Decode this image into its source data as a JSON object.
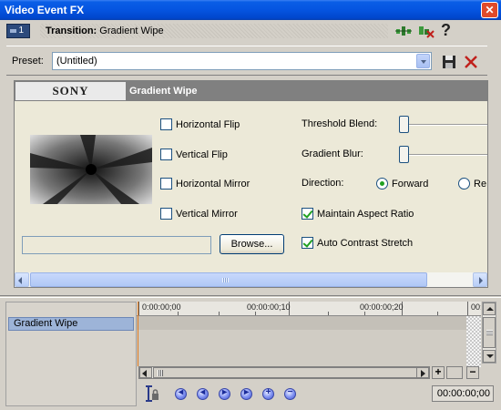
{
  "window": {
    "title": "Video Event FX",
    "close_label": "✕"
  },
  "toolbar": {
    "chain_number": "1",
    "transition_prefix": "Transition:",
    "transition_name": "Gradient Wipe",
    "help_label": "?"
  },
  "preset": {
    "label": "Preset:",
    "value": "(Untitled)"
  },
  "plugin": {
    "brand": "SONY",
    "name": "Gradient Wipe",
    "options": {
      "horizontal_flip": {
        "label": "Horizontal Flip",
        "checked": false
      },
      "vertical_flip": {
        "label": "Vertical Flip",
        "checked": false
      },
      "horizontal_mirror": {
        "label": "Horizontal Mirror",
        "checked": false
      },
      "vertical_mirror": {
        "label": "Vertical Mirror",
        "checked": false
      },
      "maintain_aspect_ratio": {
        "label": "Maintain Aspect Ratio",
        "checked": true
      },
      "auto_contrast_stretch": {
        "label": "Auto Contrast Stretch",
        "checked": true
      }
    },
    "threshold_blend": {
      "label": "Threshold Blend:",
      "value": 0
    },
    "gradient_blur": {
      "label": "Gradient Blur:",
      "value": 0
    },
    "direction": {
      "label": "Direction:",
      "options": [
        {
          "label": "Forward",
          "selected": true
        },
        {
          "label": "Re",
          "selected": false
        }
      ]
    },
    "file_path": "",
    "browse_label": "Browse..."
  },
  "timeline": {
    "track_name": "Gradient Wipe",
    "ruler_times": [
      "0:00:00;00",
      "00:00:00;10",
      "00:00:00;20",
      "00:0"
    ],
    "current_time": "00:00:00;00",
    "zoom_in_label": "+",
    "zoom_out_label": "−"
  },
  "colors": {
    "titlebar": "#0554e0",
    "panel_bg": "#ece9d8",
    "track_selected": "#9db4d8",
    "cursor": "#e07b20",
    "check_green": "#21a121"
  }
}
